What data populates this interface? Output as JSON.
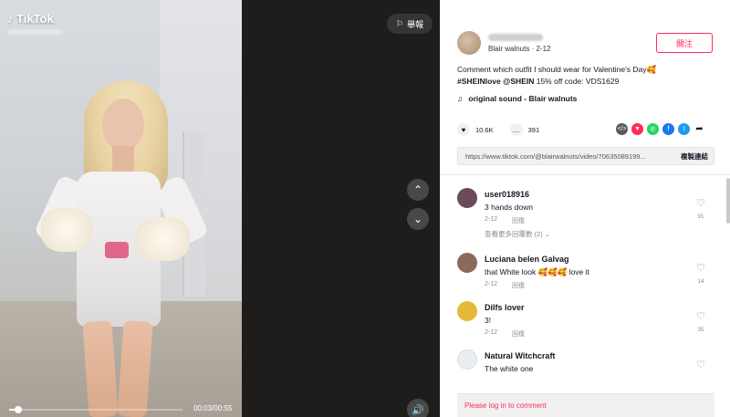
{
  "video": {
    "brand": "TikTok",
    "report_label": "舉報",
    "time": "00:03/00:55",
    "progress_fraction": 0.05
  },
  "author": {
    "display_sub": "Blair walnuts · 2-12",
    "follow_label": "關注"
  },
  "caption": {
    "line1": "Comment which outfit I should wear for Valentine's Day🥰",
    "tag1": "#SHEINlove",
    "tag2": "@SHEIN",
    "line2_rest": " 15% off code: VDS1629"
  },
  "sound": {
    "label": "original sound - Blair walnuts"
  },
  "stats": {
    "likes": "10.6K",
    "comments": "391"
  },
  "share": {
    "icons": [
      {
        "name": "embed-icon",
        "color": "#5a5a5a",
        "glyph": "</>"
      },
      {
        "name": "send-icon",
        "color": "#fe2c55",
        "glyph": "▼"
      },
      {
        "name": "whatsapp-icon",
        "color": "#25d366",
        "glyph": "✆"
      },
      {
        "name": "facebook-icon",
        "color": "#1877f2",
        "glyph": "f"
      },
      {
        "name": "twitter-icon",
        "color": "#1d9bf0",
        "glyph": "t"
      },
      {
        "name": "forward-icon",
        "color": "#ffffff",
        "glyph": "➦"
      }
    ]
  },
  "link": {
    "url": "https://www.tiktok.com/@blairwalnuts/video/70635089199...",
    "copy_label": "複製連結"
  },
  "comments": [
    {
      "name": "user018916",
      "text": "3 hands down",
      "date": "2-12",
      "reply": "回復",
      "likes": "91",
      "avatar_color": "#6b4a5a"
    },
    {
      "name": "Luciana belen Galvag",
      "text": "that White look 🥰🥰🥰 love it",
      "date": "2-12",
      "reply": "回復",
      "likes": "14",
      "avatar_color": "#8a6a5a"
    },
    {
      "name": "Dilfs lover",
      "text": "3!",
      "date": "2-12",
      "reply": "回復",
      "likes": "35",
      "avatar_color": "#e7b93a"
    },
    {
      "name": "Natural Witchcraft",
      "text": "The white one",
      "date": "",
      "reply": "",
      "likes": "",
      "avatar_color": "#e9eef0"
    }
  ],
  "more_replies": "查看更多回覆數 (2)",
  "login_prompt": "Please log in to comment"
}
